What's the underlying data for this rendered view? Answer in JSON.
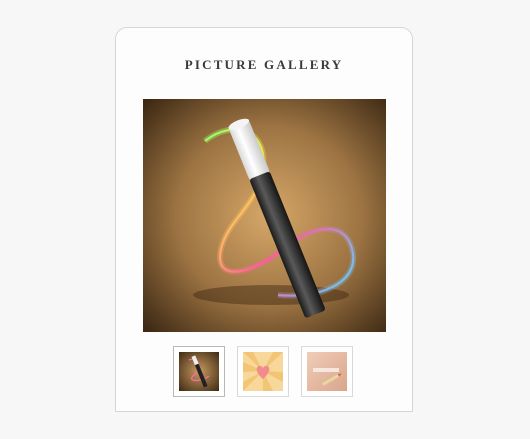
{
  "gallery": {
    "title": "PICTURE GALLERY",
    "thumbnails": [
      {
        "icon": "magic-wand-image",
        "active": true
      },
      {
        "icon": "heart-sunburst-image",
        "active": false
      },
      {
        "icon": "pencil-paper-image",
        "active": false
      }
    ]
  },
  "colors": {
    "panel_bg": "#fdfdfd",
    "panel_border": "#d6d6d6",
    "title_text": "#3a3a3a"
  }
}
